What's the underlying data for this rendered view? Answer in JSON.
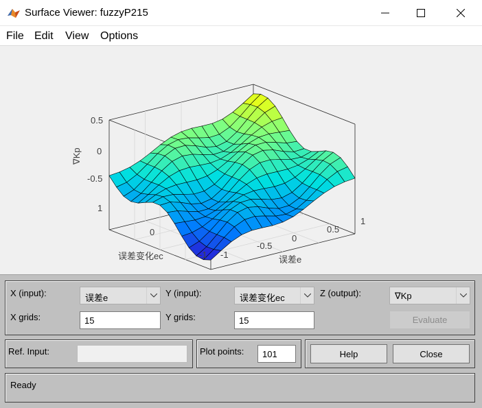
{
  "window": {
    "title": "Surface Viewer: fuzzyP215",
    "minimize_icon": "minimize-icon",
    "maximize_icon": "maximize-icon",
    "close_icon": "close-icon"
  },
  "menu": {
    "items": [
      "File",
      "Edit",
      "View",
      "Options"
    ]
  },
  "plot": {
    "z_label": "∇Kp",
    "x_label": "误差e",
    "y_label": "误差变化ec",
    "z_ticks": [
      "0.5",
      "0",
      "-0.5"
    ],
    "x_ticks": [
      "-1",
      "-0.5",
      "0",
      "0.5",
      "1"
    ],
    "y_ticks": [
      "1",
      "0",
      "-1"
    ],
    "colormap": [
      "#3300c8",
      "#0080ff",
      "#00e0e0",
      "#80ff80",
      "#ffff00"
    ]
  },
  "controls": {
    "x_input_label": "X (input):",
    "x_input_value": "误差e",
    "y_input_label": "Y (input):",
    "y_input_value": "误差变化ec",
    "z_output_label": "Z (output):",
    "z_output_value": "∇Kp",
    "x_grids_label": "X grids:",
    "x_grids_value": "15",
    "y_grids_label": "Y grids:",
    "y_grids_value": "15",
    "evaluate_label": "Evaluate",
    "ref_input_label": "Ref. Input:",
    "ref_input_value": "",
    "plot_points_label": "Plot points:",
    "plot_points_value": "101",
    "help_label": "Help",
    "close_label": "Close",
    "status": "Ready"
  }
}
